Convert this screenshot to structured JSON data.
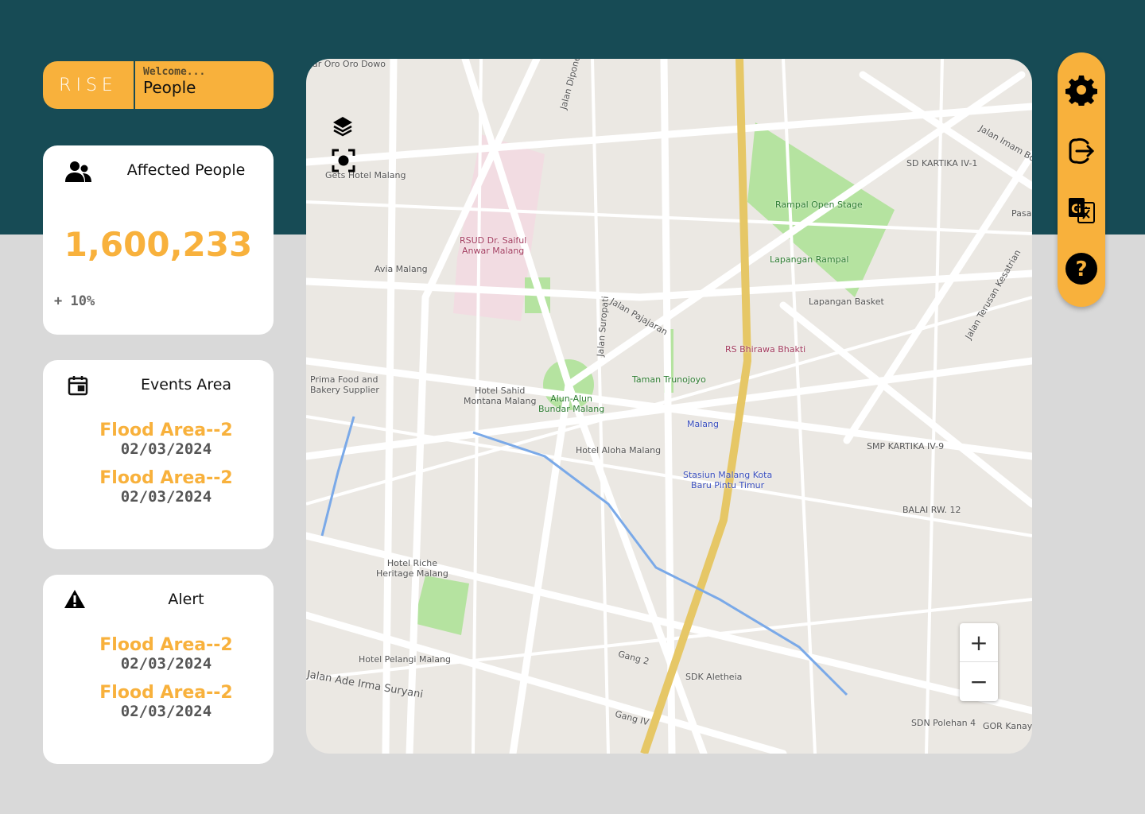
{
  "brand": {
    "logo": "RISE",
    "welcome": "Welcome...",
    "user": "People"
  },
  "affected": {
    "title": "Affected People",
    "count": "1,600,233",
    "change": "+ 10%"
  },
  "events": {
    "title": "Events Area",
    "items": [
      {
        "name": "Flood Area--2",
        "date": "02/03/2024"
      },
      {
        "name": "Flood Area--2",
        "date": "02/03/2024"
      }
    ]
  },
  "alert": {
    "title": "Alert",
    "items": [
      {
        "name": "Flood Area--2",
        "date": "02/03/2024"
      },
      {
        "name": "Flood Area--2",
        "date": "02/03/2024"
      }
    ]
  },
  "map": {
    "labels": [
      "ar Oro Oro Dowo",
      "Gets Hotel Malang",
      "RSUD Dr. Saiful",
      "Anwar Malang",
      "Avia Malang",
      "Jalan Suropati",
      "Jalan Pajajaran",
      "Rampal Open Stage",
      "Lapangan Rampal",
      "Lapangan Basket",
      "RS Bhirawa Bhakti",
      "SD KARTIKA IV-1",
      "Jalan Imam Bo",
      "Prima Food and",
      "Bakery Supplier",
      "Hotel Sahid",
      "Montana Malang",
      "Alun-Alun",
      "Bundar Malang",
      "Taman Trunojoyo",
      "Malang",
      "Hotel Aloha Malang",
      "Stasiun Malang Kota",
      "Baru Pintu Timur",
      "SMP KARTIKA IV-9",
      "BALAI RW. 12",
      "Hotel Riche",
      "Heritage Malang",
      "Hotel Pelangi Malang",
      "Jalan Ade Irma Suryani",
      "Gang 2",
      "SDK Aletheia",
      "Gang IV",
      "SDN Polehan 4",
      "GOR Kanaya",
      "Jalan Terusan Kesatrian",
      "Pasa",
      "Jalan Diponeg"
    ],
    "zoom_in": "+",
    "zoom_out": "−"
  },
  "colors": {
    "accent": "#f8b13c",
    "header": "#174b55",
    "background": "#d9d9d9"
  }
}
